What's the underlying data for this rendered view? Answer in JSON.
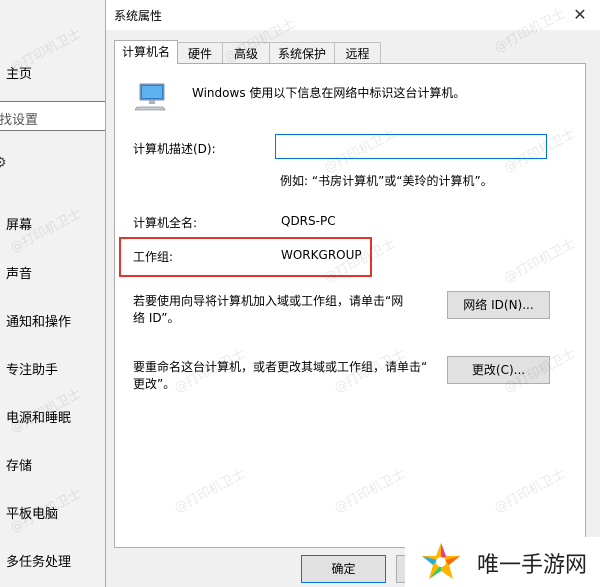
{
  "settings_sidebar": {
    "home": "主页",
    "search_placeholder": "找设置",
    "items": [
      "屏幕",
      "声音",
      "通知和操作",
      "专注助手",
      "电源和睡眠",
      "存储",
      "平板电脑",
      "多任务处理"
    ]
  },
  "dialog": {
    "title": "系统属性",
    "close_glyph": "✕",
    "tabs": [
      "计算机名",
      "硬件",
      "高级",
      "系统保护",
      "远程"
    ],
    "active_tab_index": 0,
    "intro": "Windows 使用以下信息在网络中标识这台计算机。",
    "description_label": "计算机描述(D):",
    "description_value": "",
    "description_example": "例如: “书房计算机”或“美玲的计算机”。",
    "full_name_label": "计算机全名:",
    "full_name_value": "QDRS-PC",
    "workgroup_label": "工作组:",
    "workgroup_value": "WORKGROUP",
    "network_text_line1": "若要使用向导将计算机加入域或工作组，请单击“网",
    "network_text_line2": "络 ID”。",
    "network_button": "网络 ID(N)...",
    "rename_text_line1": "要重命名这台计算机，或者更改其域或工作组，请单击“",
    "rename_text_line2": "更改”。",
    "change_button": "更改(C)...",
    "ok_button": "确定"
  },
  "watermark": "@打印机卫士",
  "corner_logo": {
    "text": "唯一手游网"
  },
  "colors": {
    "highlight": "#e4332d",
    "focus_border": "#0078d7"
  }
}
